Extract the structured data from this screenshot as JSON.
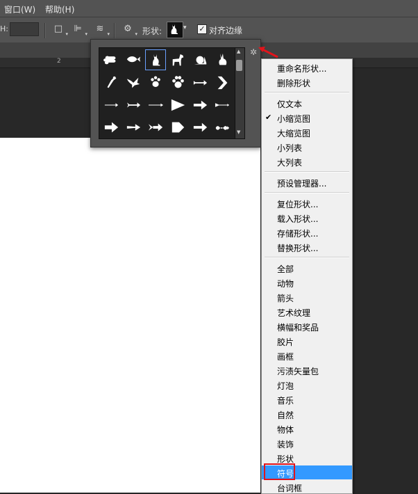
{
  "menubar": {
    "items": [
      "窗口(W)",
      "帮助(H)"
    ]
  },
  "options_bar": {
    "h_label": "H:",
    "shape_label": "形状:",
    "align_edges_label": "对齐边缘",
    "align_edges_checked": true
  },
  "ruler": {
    "label": "2"
  },
  "shape_panel": {
    "shapes": [
      "bone",
      "fish",
      "cat",
      "dog",
      "snail",
      "rabbit",
      "bird",
      "dove",
      "paw-print",
      "paw-print-2",
      "arrow-feather",
      "chevron-right",
      "arrow-thin",
      "arrow-feathered",
      "arrow-long",
      "triangle-arrow",
      "arrow-bold",
      "arrow-fletched",
      "arrow-block",
      "arrow-tapered",
      "arrow-double-feather",
      "arrow-pentagon",
      "arrow-heavy",
      "arrow-wavy"
    ],
    "selected_index": 2
  },
  "menu": {
    "items": [
      {
        "label": "重命名形状..."
      },
      {
        "label": "删除形状"
      },
      {
        "sep": true
      },
      {
        "label": "仅文本"
      },
      {
        "label": "小缩览图",
        "checked": true
      },
      {
        "label": "大缩览图"
      },
      {
        "label": "小列表"
      },
      {
        "label": "大列表"
      },
      {
        "sep": true
      },
      {
        "label": "预设管理器..."
      },
      {
        "sep": true
      },
      {
        "label": "复位形状..."
      },
      {
        "label": "载入形状..."
      },
      {
        "label": "存储形状..."
      },
      {
        "label": "替换形状..."
      },
      {
        "sep": true
      },
      {
        "label": "全部"
      },
      {
        "label": "动物"
      },
      {
        "label": "箭头"
      },
      {
        "label": "艺术纹理"
      },
      {
        "label": "横幅和奖品"
      },
      {
        "label": "胶片"
      },
      {
        "label": "画框"
      },
      {
        "label": "污渍矢量包"
      },
      {
        "label": "灯泡"
      },
      {
        "label": "音乐"
      },
      {
        "label": "自然"
      },
      {
        "label": "物体"
      },
      {
        "label": "装饰"
      },
      {
        "label": "形状"
      },
      {
        "label": "符号",
        "highlighted": true
      },
      {
        "label": "台词框"
      }
    ]
  },
  "colors": {
    "highlight": "#3399ff",
    "annotation": "#e2141b"
  }
}
